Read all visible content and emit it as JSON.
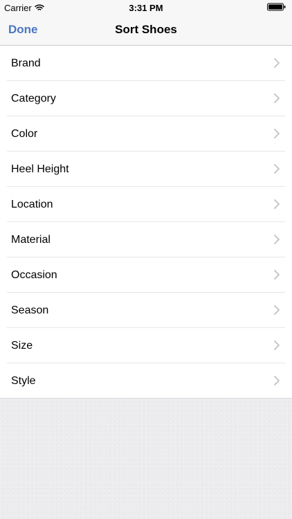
{
  "status_bar": {
    "carrier": "Carrier",
    "time": "3:31 PM",
    "icons": {
      "wifi": "wifi-icon",
      "battery": "battery-icon"
    }
  },
  "nav_bar": {
    "done_label": "Done",
    "title": "Sort Shoes"
  },
  "sort_options": [
    {
      "label": "Brand",
      "icon": "chevron-right-icon"
    },
    {
      "label": "Category",
      "icon": "chevron-right-icon"
    },
    {
      "label": "Color",
      "icon": "chevron-right-icon"
    },
    {
      "label": "Heel Height",
      "icon": "chevron-right-icon"
    },
    {
      "label": "Location",
      "icon": "chevron-right-icon"
    },
    {
      "label": "Material",
      "icon": "chevron-right-icon"
    },
    {
      "label": "Occasion",
      "icon": "chevron-right-icon"
    },
    {
      "label": "Season",
      "icon": "chevron-right-icon"
    },
    {
      "label": "Size",
      "icon": "chevron-right-icon"
    },
    {
      "label": "Style",
      "icon": "chevron-right-icon"
    }
  ],
  "colors": {
    "accent": "#4a76c2",
    "background": "#efeff4",
    "separator": "#e6e6e9",
    "chevron": "#c7c7cc"
  }
}
